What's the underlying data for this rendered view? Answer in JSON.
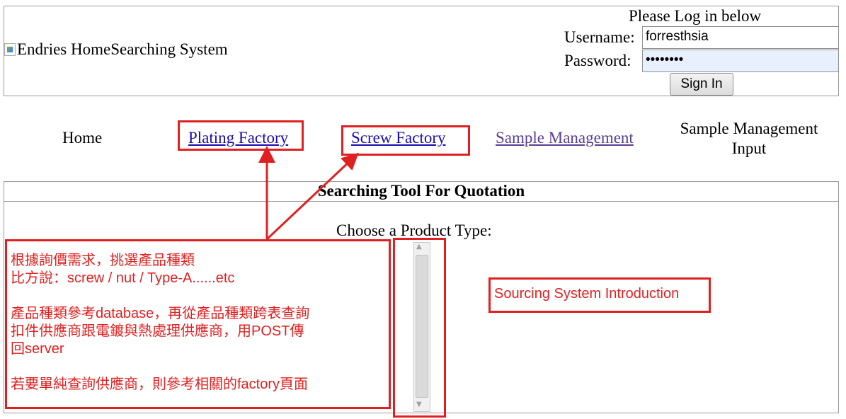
{
  "header": {
    "logo_alt": "Endries Home",
    "system_title": "Searching System",
    "login_title": "Please Log in below",
    "username_label": "Username:",
    "username_value": "forresthsia",
    "password_label": "Password:",
    "password_value": "••••••••",
    "signin_label": "Sign In"
  },
  "nav": {
    "home": "Home",
    "plating": "Plating Factory",
    "screw": "Screw Factory",
    "sample_management": "Sample Management",
    "sample_management_input_line1": "Sample Management",
    "sample_management_input_line2": "Input"
  },
  "main": {
    "title": "Searching Tool For Quotation",
    "choose_label": "Choose a Product Type:"
  },
  "annotation": {
    "lines": [
      "根據詢價需求，挑選產品種類",
      "比方說：screw / nut / Type-A......etc",
      "",
      "產品種類參考database，再從產品種類跨表查詢",
      "扣件供應商跟電鍍與熱處理供應商，用POST傳",
      "回server",
      "",
      "若要單純查詢供應商，則參考相關的factory頁面"
    ],
    "sourcing": "Sourcing System Introduction",
    "color": "#e02020"
  },
  "colors": {
    "link": "#1a0dab",
    "visited_link": "#5b3e91",
    "annotation_red": "#e02020",
    "autofill_bg": "#e8f0fe"
  }
}
